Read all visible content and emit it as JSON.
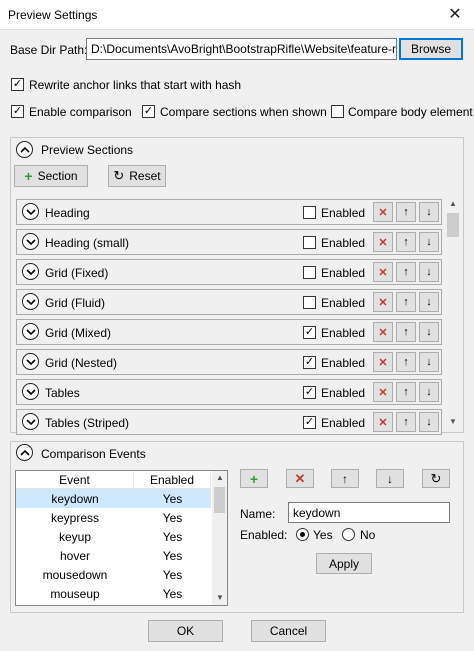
{
  "window": {
    "title": "Preview Settings",
    "close_glyph": "✕"
  },
  "base_dir": {
    "label": "Base Dir Path:",
    "value": "D:\\Documents\\AvoBright\\BootstrapRifle\\Website\\feature-reso",
    "browse": "Browse"
  },
  "options": {
    "rewrite_anchor": {
      "label": "Rewrite anchor links that start with hash",
      "checked": true
    },
    "enable_comparison": {
      "label": "Enable comparison",
      "checked": true
    },
    "compare_sections": {
      "label": "Compare sections when shown",
      "checked": true
    },
    "compare_body": {
      "label": "Compare body element",
      "checked": false
    }
  },
  "preview_sections": {
    "title": "Preview Sections",
    "add_label": "Section",
    "reset_label": "Reset",
    "enabled_label": "Enabled",
    "rows": [
      {
        "name": "Heading",
        "enabled": false
      },
      {
        "name": "Heading (small)",
        "enabled": false
      },
      {
        "name": "Grid (Fixed)",
        "enabled": false
      },
      {
        "name": "Grid (Fluid)",
        "enabled": false
      },
      {
        "name": "Grid (Mixed)",
        "enabled": true
      },
      {
        "name": "Grid (Nested)",
        "enabled": true
      },
      {
        "name": "Tables",
        "enabled": true
      },
      {
        "name": "Tables (Striped)",
        "enabled": true
      }
    ]
  },
  "comparison_events": {
    "title": "Comparison Events",
    "columns": [
      "Event",
      "Enabled"
    ],
    "rows": [
      {
        "event": "keydown",
        "enabled": "Yes",
        "selected": true
      },
      {
        "event": "keypress",
        "enabled": "Yes"
      },
      {
        "event": "keyup",
        "enabled": "Yes"
      },
      {
        "event": "hover",
        "enabled": "Yes"
      },
      {
        "event": "mousedown",
        "enabled": "Yes"
      },
      {
        "event": "mouseup",
        "enabled": "Yes"
      }
    ],
    "name_label": "Name:",
    "name_value": "keydown",
    "enabled_label": "Enabled:",
    "yes_label": "Yes",
    "no_label": "No",
    "enabled_value": "Yes",
    "apply": "Apply"
  },
  "footer": {
    "ok": "OK",
    "cancel": "Cancel"
  },
  "colors": {
    "add_green": "#2e9e2e",
    "delete_red": "#c0392b",
    "selection": "#cde8ff",
    "focus_blue": "#0078d7"
  },
  "icons": [
    "close-icon",
    "plus-icon",
    "reset-icon",
    "chevron-up-icon",
    "chevron-down-icon",
    "delete-icon",
    "arrow-up-icon",
    "arrow-down-icon",
    "refresh-icon"
  ]
}
